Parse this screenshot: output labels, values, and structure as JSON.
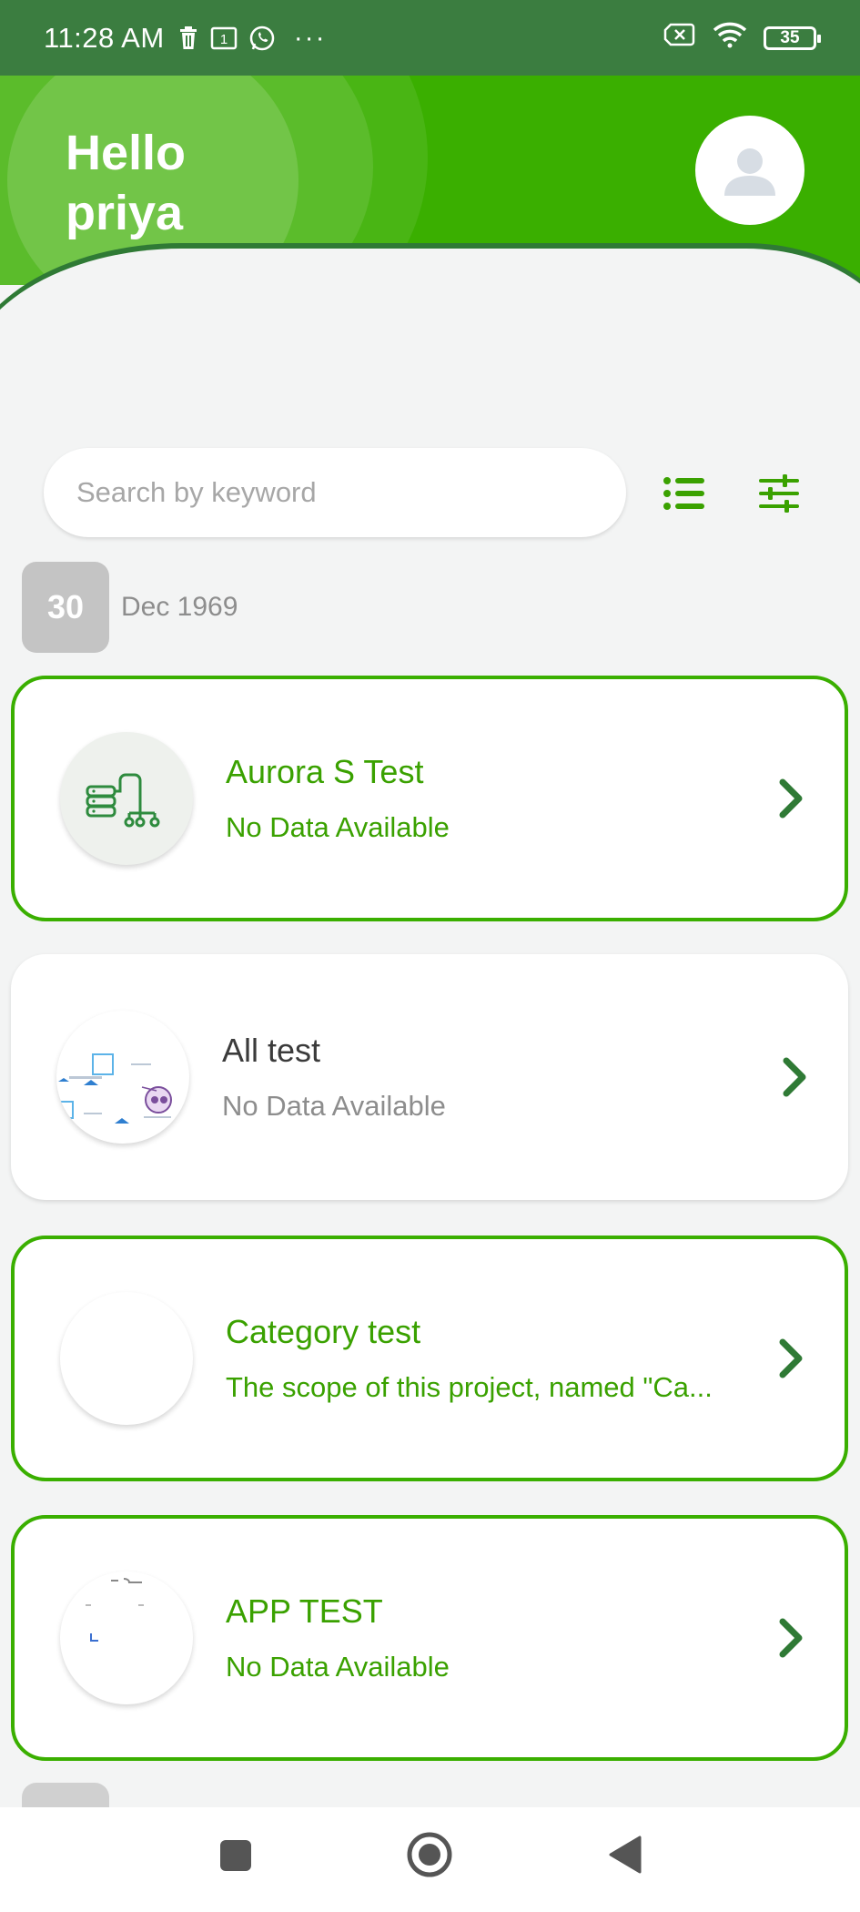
{
  "status_bar": {
    "time": "11:28 AM",
    "notification_count": "1",
    "more": "···",
    "battery": "35"
  },
  "header": {
    "greeting_line1": "Hello",
    "greeting_line2": "priya"
  },
  "search": {
    "placeholder": "Search by keyword",
    "value": ""
  },
  "date_group": {
    "day": "30",
    "month_year": "Dec 1969"
  },
  "projects": [
    {
      "title": "Aurora S Test",
      "subtitle": "No Data Available",
      "active": true,
      "thumb_icon": "database-tree-icon"
    },
    {
      "title": "All test",
      "subtitle": "No Data Available",
      "active": false,
      "thumb_icon": "diagram-thumbnail"
    },
    {
      "title": "Category test",
      "subtitle": "The scope of this project, named \"Ca...",
      "active": true,
      "thumb_icon": "blank-thumbnail"
    },
    {
      "title": "APP TEST",
      "subtitle": "No Data Available",
      "active": true,
      "thumb_icon": "sketch-thumbnail"
    }
  ],
  "colors": {
    "brand_green": "#3aaf00",
    "status_bar_green": "#3b7d40",
    "chevron_green": "#2f7a35"
  }
}
